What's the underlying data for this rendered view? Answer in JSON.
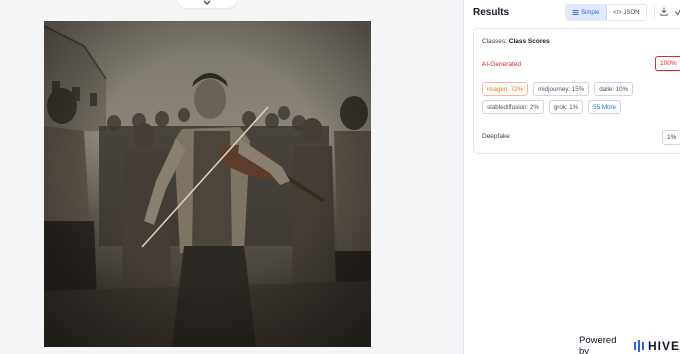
{
  "results": {
    "title": "Results",
    "view_toggle": {
      "simple_label": "Simple",
      "json_label": "</> JSON"
    },
    "card": {
      "classes_prefix": "Classes:",
      "classes_title": "Class Scores",
      "ai_generated": {
        "label": "AI-Generated",
        "percent": "100%"
      },
      "sources": [
        {
          "label": "imagen: 72%",
          "highlight": true
        },
        {
          "label": "midjourney: 15%",
          "highlight": false
        },
        {
          "label": "dalle: 10%",
          "highlight": false
        },
        {
          "label": "stablediffusion: 2%",
          "highlight": false
        },
        {
          "label": "grok: 1%",
          "highlight": false
        }
      ],
      "more_label": "55 More",
      "deepfake": {
        "label": "Deepfake",
        "percent": "1%"
      }
    }
  },
  "footer": {
    "powered_by": "Powered by",
    "brand": "HIVE"
  },
  "colors": {
    "accent_red": "#dc2626",
    "accent_blue": "#2563eb",
    "highlight_orange": "#f97316"
  },
  "icons": {
    "collapse": "chevron-down-icon",
    "simple": "list-icon",
    "download": "download-icon",
    "share": "share-icon",
    "brand": "hive-logo-icon"
  }
}
